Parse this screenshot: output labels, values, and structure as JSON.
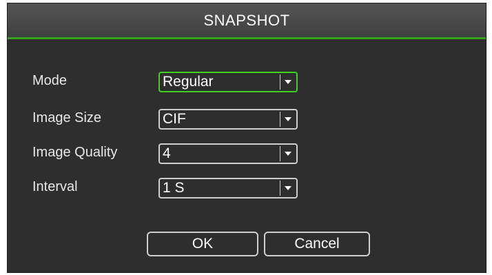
{
  "dialog": {
    "title": "SNAPSHOT",
    "accent_color": "#3fd11e",
    "fields": [
      {
        "label": "Mode",
        "value": "Regular",
        "focused": true
      },
      {
        "label": "Image Size",
        "value": "CIF"
      },
      {
        "label": "Image Quality",
        "value": "4"
      },
      {
        "label": "Interval",
        "value": "1 S"
      }
    ],
    "buttons": {
      "ok": "OK",
      "cancel": "Cancel"
    },
    "icons": {
      "dropdown": "chevron-down-icon"
    }
  }
}
